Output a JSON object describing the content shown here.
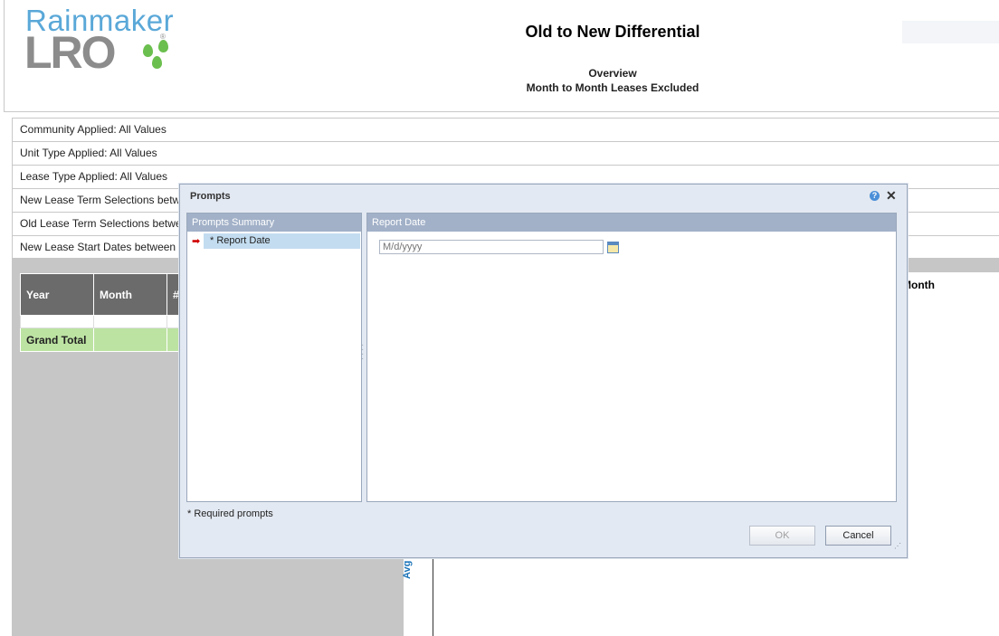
{
  "header": {
    "logo_top": "Rainmaker",
    "logo_bottom": "LRO",
    "logo_reg": "®",
    "title": "Old to New Differential",
    "overview": "Overview",
    "subtitle": "Month to Month Leases Excluded"
  },
  "filters": [
    "Community Applied: All Values",
    "Unit Type Applied: All Values",
    "Lease Type Applied: All Values",
    "New Lease Term Selections betw",
    "Old Lease Term Selections betwe",
    "New Lease Start Dates between"
  ],
  "table": {
    "headers": [
      "Year",
      "Month",
      "#"
    ],
    "grand_total": "Grand Total"
  },
  "chart_bits": {
    "month_label": "Month",
    "axis_label": "Avg Rent V"
  },
  "dialog": {
    "title": "Prompts",
    "help_icon": "?",
    "close_icon": "✕",
    "summary_header": "Prompts Summary",
    "summary_item": "* Report Date",
    "date_header": "Report Date",
    "date_placeholder": "M/d/yyyy",
    "required_note": "* Required prompts",
    "ok_label": "OK",
    "cancel_label": "Cancel"
  },
  "colors": {
    "accent_blue": "#5aa8d8",
    "logo_grey": "#8c8c8c",
    "logo_green": "#6bbf4e",
    "panel_header": "#a2b1c8",
    "grand_total_bg": "#bde3a3"
  }
}
